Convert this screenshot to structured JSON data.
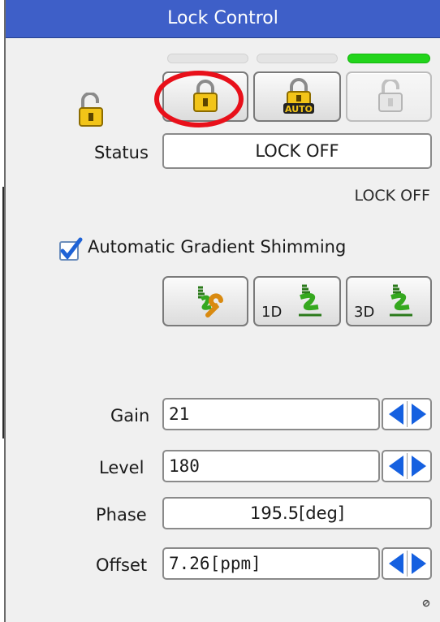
{
  "window": {
    "title": "Lock Control"
  },
  "status": {
    "label": "Status",
    "value": "LOCK OFF",
    "state_text": "LOCK OFF"
  },
  "lock_buttons": [
    {
      "name": "lock-on",
      "icon": "padlock-closed-icon"
    },
    {
      "name": "auto-lock",
      "icon": "padlock-auto-icon",
      "icon_text": "AUTO"
    },
    {
      "name": "lock-off",
      "icon": "padlock-open-icon",
      "disabled": true
    }
  ],
  "lock_indicators": [
    {
      "on": false
    },
    {
      "on": false
    },
    {
      "on": true
    }
  ],
  "gradient_shimming": {
    "checkbox_label": "Automatic Gradient Shimming",
    "checked": true,
    "buttons": [
      {
        "icon": "shim-wrench-icon",
        "sub": ""
      },
      {
        "icon": "shim-coil-icon",
        "sub": "1D"
      },
      {
        "icon": "shim-coil-icon",
        "sub": "3D"
      }
    ]
  },
  "params": {
    "gain": {
      "label": "Gain",
      "value": "21"
    },
    "level": {
      "label": "Level",
      "value": "180"
    },
    "phase": {
      "label": "Phase",
      "value": "195.5[deg]"
    },
    "offset": {
      "label": "Offset",
      "value": "7.26[ppm]"
    }
  },
  "colors": {
    "titlebar": "#3e5fc8",
    "indicator_on": "#22d41b",
    "annotation": "#e8101a",
    "spin_arrow": "#1560e0"
  }
}
